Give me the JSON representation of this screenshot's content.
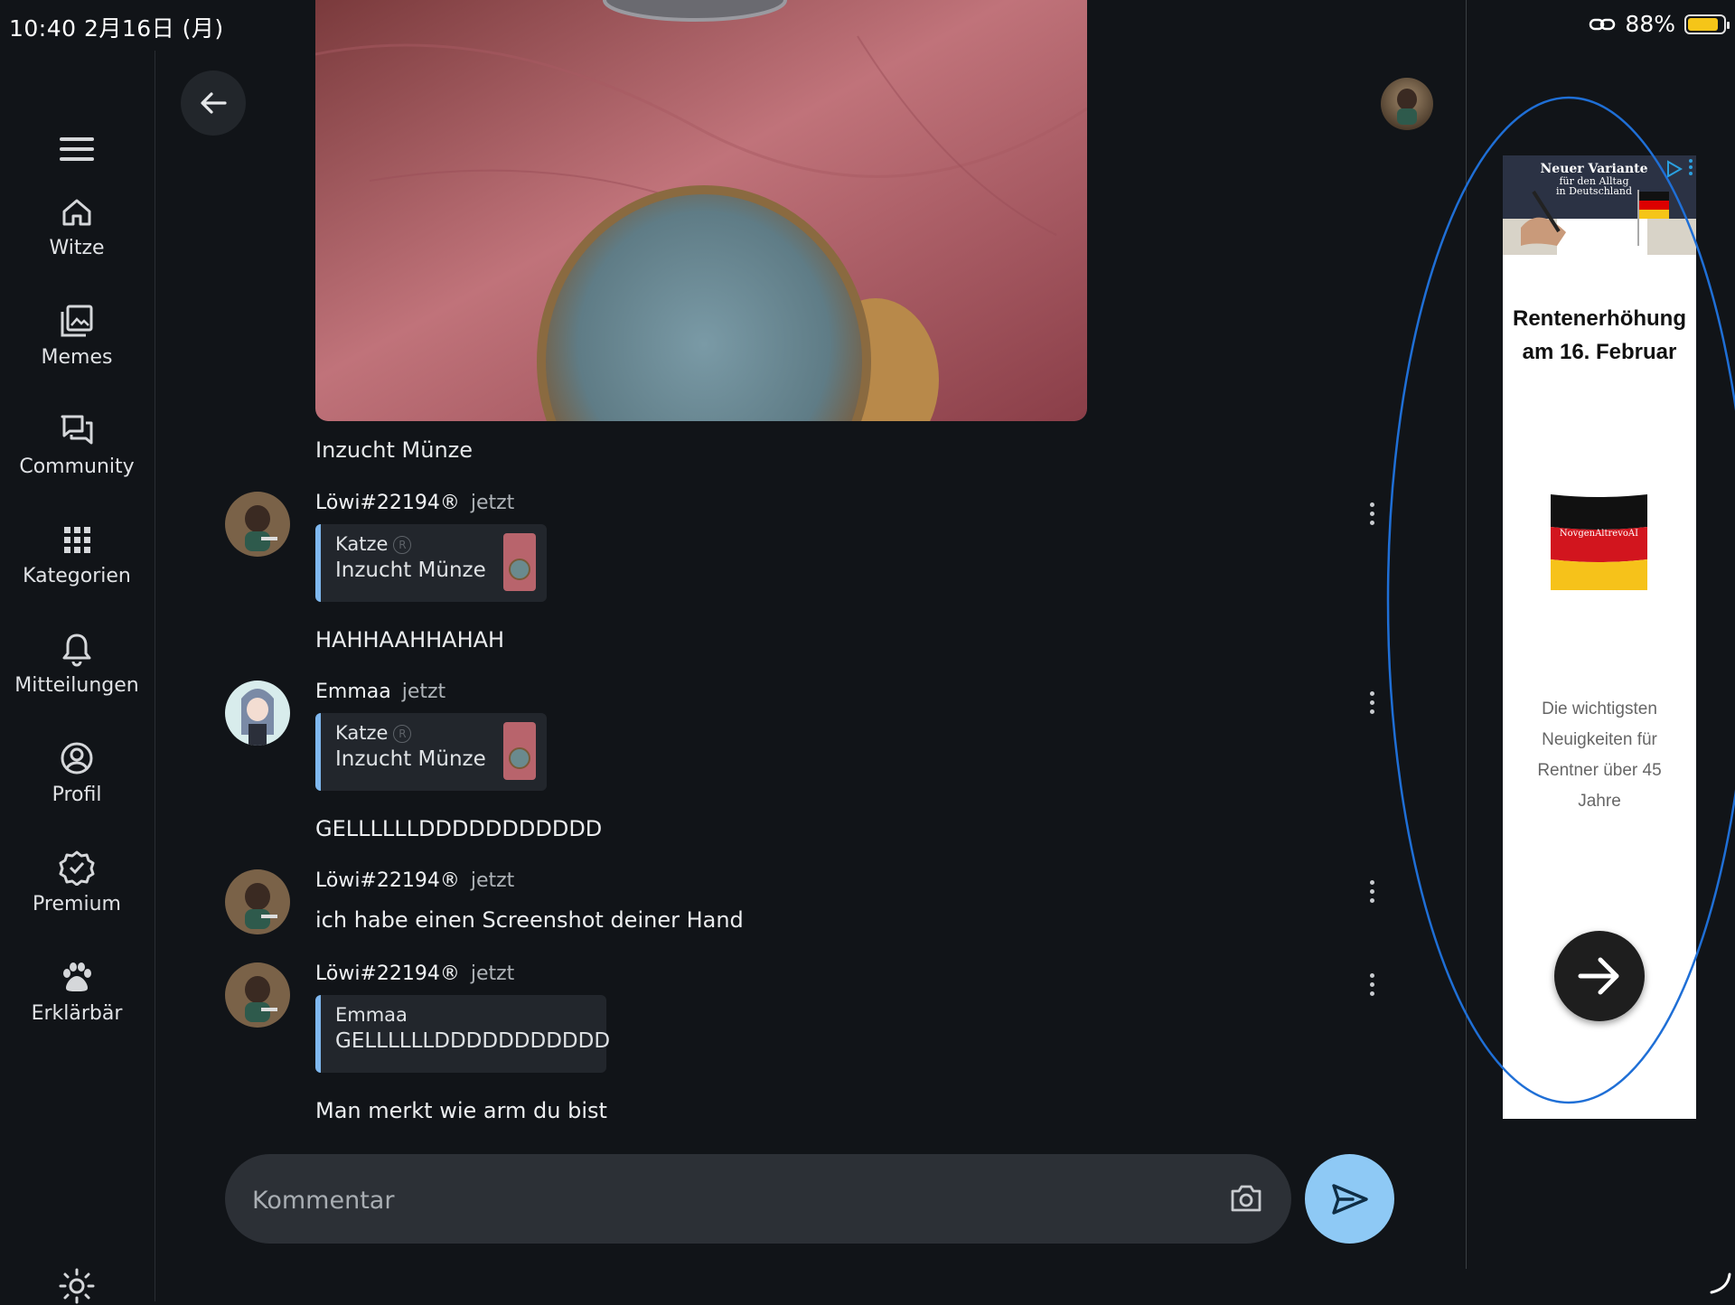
{
  "status_bar": {
    "time_date": "10:40   2月16日 (月)",
    "battery_percent": "88%",
    "battery_level": 0.88
  },
  "sidebar": {
    "items": [
      {
        "label": "Witze",
        "icon": "home-icon"
      },
      {
        "label": "Memes",
        "icon": "image-gallery-icon"
      },
      {
        "label": "Community",
        "icon": "forum-icon"
      },
      {
        "label": "Kategorien",
        "icon": "grid-icon"
      },
      {
        "label": "Mitteilungen",
        "icon": "bell-icon"
      },
      {
        "label": "Profil",
        "icon": "account-circle-icon"
      },
      {
        "label": "Premium",
        "icon": "verified-badge-icon"
      },
      {
        "label": "Erklärbär",
        "icon": "paw-icon"
      }
    ],
    "theme_icon": "sun-icon",
    "menu_icon": "hamburger-menu-icon"
  },
  "post": {
    "caption": "Inzucht Münze"
  },
  "comments": [
    {
      "author": "Löwi#22194®",
      "time": "jetzt",
      "quote": {
        "author": "Katze",
        "text": "Inzucht Münze"
      },
      "text": "HAHHAAHHAHAH"
    },
    {
      "author": "Emmaa",
      "time": "jetzt",
      "quote": {
        "author": "Katze",
        "text": "Inzucht Münze"
      },
      "text": "GELLLLLLDDDDDDDDDDD"
    },
    {
      "author": "Löwi#22194®",
      "time": "jetzt",
      "text": "ich habe einen Screenshot deiner Hand"
    },
    {
      "author": "Löwi#22194®",
      "time": "jetzt",
      "quote": {
        "author": "Emmaa",
        "text": "GELLLLLLDDDDDDDDDDD"
      },
      "text": "Man merkt wie arm du bist"
    }
  ],
  "composer": {
    "placeholder": "Kommentar"
  },
  "ad": {
    "banner_line1": "Neuer Variante",
    "banner_line2": "für den Alltag",
    "banner_line3": "in Deutschland",
    "title": "Rentenerhöhung am 16. Februar",
    "flag_text": "NovgenAltrevoAI",
    "description": "Die wichtigsten Neuigkeiten für Rentner über 45 Jahre"
  },
  "colors": {
    "background": "#111418",
    "accent": "#8ec9f5",
    "quote_bar": "#7fb8ef",
    "annotation": "#1f6fd6"
  }
}
